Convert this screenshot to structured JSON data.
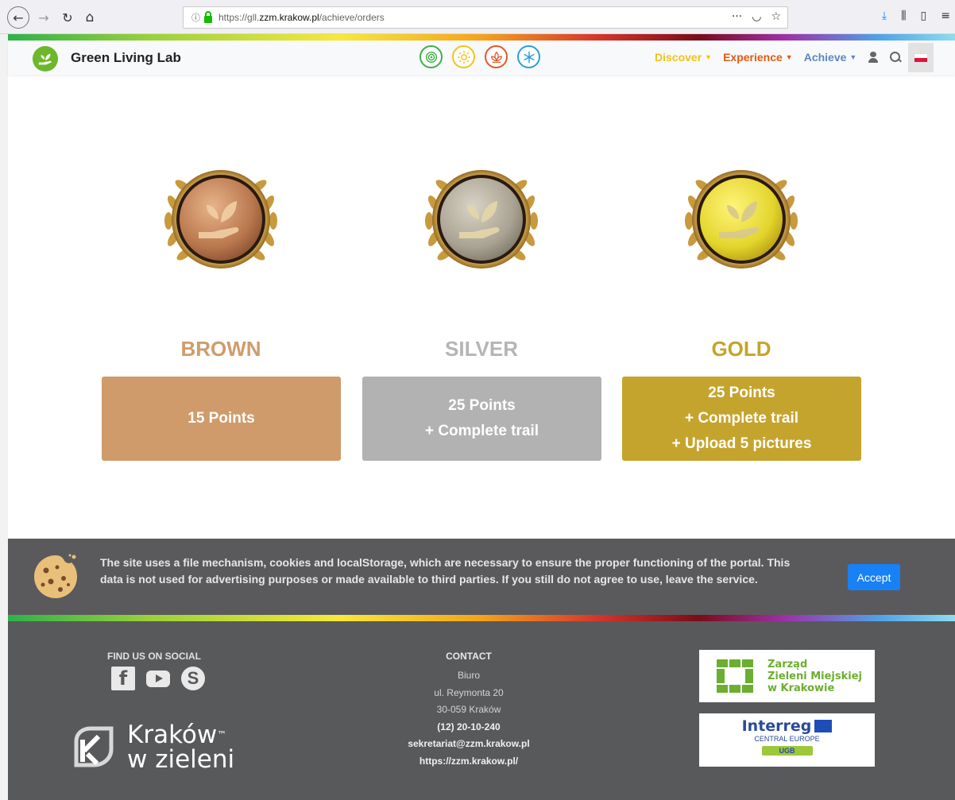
{
  "browser": {
    "url_prefix": "https://gll.",
    "url_domain": "zzm.krakow.pl",
    "url_path": "/achieve/orders",
    "icons": [
      "back-arrow-icon",
      "forward-arrow-icon",
      "reload-icon",
      "home-icon",
      "info-icon",
      "lock-icon",
      "more-icon",
      "pocket-icon",
      "star-icon",
      "download-icon",
      "library-icon",
      "sidebar-icon",
      "menu-icon"
    ]
  },
  "header": {
    "brand": "Green Living Lab",
    "season_icons": [
      "spring-icon",
      "summer-icon",
      "autumn-icon",
      "winter-icon"
    ],
    "nav": {
      "discover": "Discover",
      "experience": "Experience",
      "achieve": "Achieve"
    }
  },
  "tiers": [
    {
      "label": "BROWN",
      "lines": [
        "15 Points"
      ],
      "color": "#d09b6a"
    },
    {
      "label": "SILVER",
      "lines": [
        "25 Points",
        "+ Complete trail"
      ],
      "color": "#b2b2b2"
    },
    {
      "label": "GOLD",
      "lines": [
        "25 Points",
        "+ Complete trail",
        "+ Upload 5 pictures"
      ],
      "color": "#c5a42e"
    }
  ],
  "cookie": {
    "text": "The site uses a file mechanism, cookies and localStorage, which are necessary to ensure the proper functioning of the portal. This data is not used for advertising purposes or made available to third parties. If you still do not agree to use, leave the service.",
    "accept_label": "Accept"
  },
  "footer": {
    "social_title": "FIND US ON SOCIAL",
    "krakow_line1": "Kraków",
    "krakow_tm": "™",
    "krakow_line2": "w zieleni",
    "contact_title": "CONTACT",
    "contact_office": "Biuro",
    "contact_street": "ul. Reymonta 20",
    "contact_city": "30-059 Kraków",
    "contact_phone": "(12) 20-10-240",
    "contact_email": "sekretariat@zzm.krakow.pl",
    "contact_web": "https://zzm.krakow.pl/",
    "zzm_line1": "Zarząd",
    "zzm_line2": "Zieleni Miejskiej",
    "zzm_line3": "w Krakowie",
    "interreg_title": "Interreg",
    "interreg_sub": "CENTRAL EUROPE",
    "interreg_project": "UGB"
  }
}
